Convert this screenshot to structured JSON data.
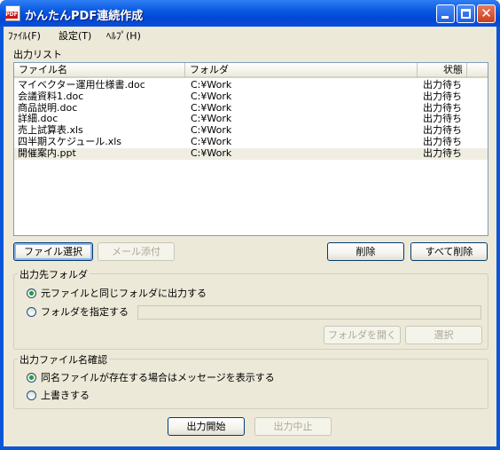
{
  "window": {
    "title": "かんたんPDF連続作成",
    "app_icon_text": "PDF",
    "minimize_icon": "minimize-icon",
    "maximize_icon": "maximize-icon",
    "close_glyph": "✕"
  },
  "menu": {
    "items": [
      "ﾌｧｲﾙ(F)",
      "設定(T)",
      "ﾍﾙﾌﾟ(H)"
    ]
  },
  "output_list": {
    "label": "出力リスト",
    "columns": [
      "ファイル名",
      "フォルダ",
      "状態"
    ],
    "rows": [
      {
        "name": "マイベクター運用仕様書.doc",
        "folder": "C:¥Work",
        "status": "出力待ち"
      },
      {
        "name": "会議資料1.doc",
        "folder": "C:¥Work",
        "status": "出力待ち"
      },
      {
        "name": "商品説明.doc",
        "folder": "C:¥Work",
        "status": "出力待ち"
      },
      {
        "name": "詳細.doc",
        "folder": "C:¥Work",
        "status": "出力待ち"
      },
      {
        "name": "売上試算表.xls",
        "folder": "C:¥Work",
        "status": "出力待ち"
      },
      {
        "name": "四半期スケジュール.xls",
        "folder": "C:¥Work",
        "status": "出力待ち"
      },
      {
        "name": "開催案内.ppt",
        "folder": "C:¥Work",
        "status": "出力待ち"
      }
    ]
  },
  "list_buttons": {
    "select_file": "ファイル選択",
    "mail_attach": "メール添付",
    "delete": "削除",
    "delete_all": "すべて削除"
  },
  "output_folder": {
    "title": "出力先フォルダ",
    "option_same": "元ファイルと同じフォルダに出力する",
    "option_specify": "フォルダを指定する",
    "folder_value": "",
    "open_folder_button": "フォルダを開く",
    "select_button": "選択"
  },
  "filename_check": {
    "title": "出力ファイル名確認",
    "option_message": "同名ファイルが存在する場合はメッセージを表示する",
    "option_overwrite": "上書きする"
  },
  "actions": {
    "start": "出力開始",
    "stop": "出力中止"
  }
}
